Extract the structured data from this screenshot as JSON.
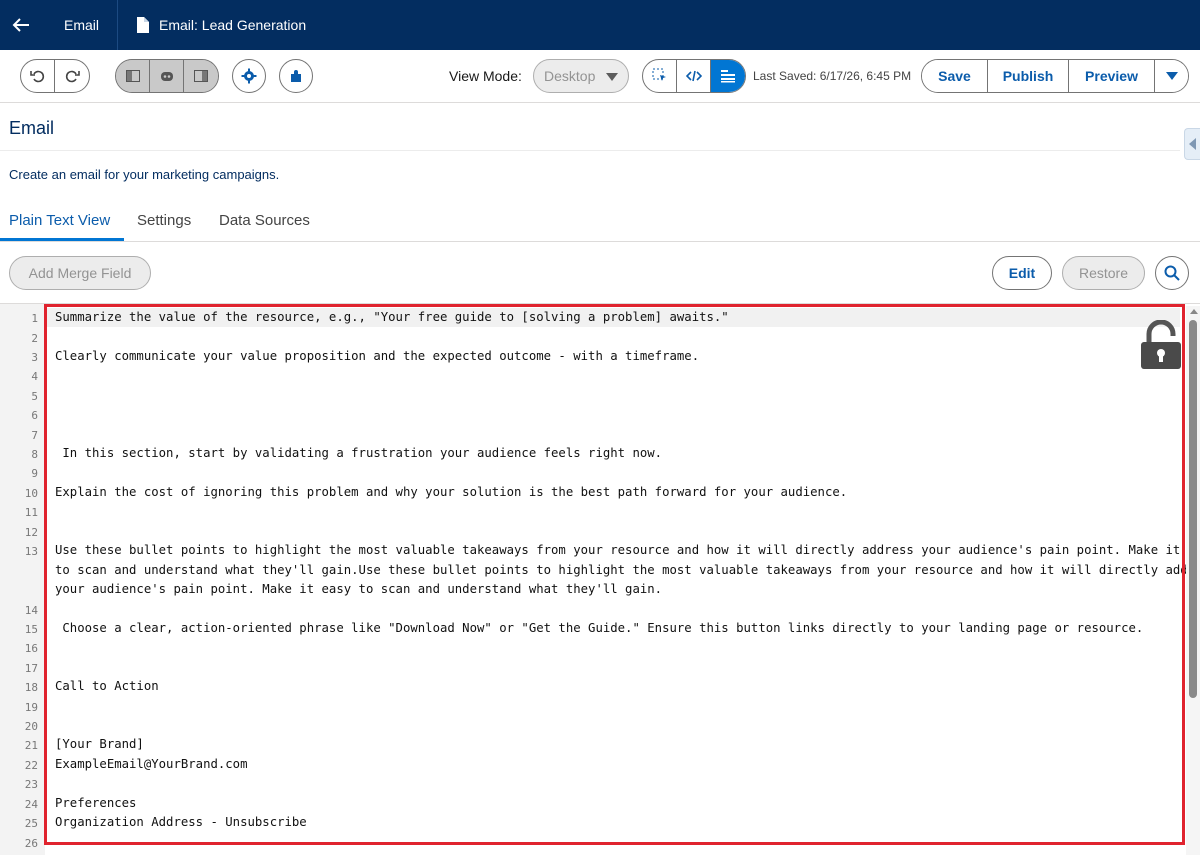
{
  "topbar": {
    "back_icon": "arrow-left-icon",
    "crumb1": "Email",
    "crumb2": "Email: Lead Generation",
    "doc_icon": "document-icon"
  },
  "toolbar": {
    "undo_icon": "undo-icon",
    "redo_icon": "redo-icon",
    "view_mode_label": "View Mode:",
    "view_mode_value": "Desktop",
    "last_saved": "Last Saved: 6/17/26, 6:45 PM",
    "save_label": "Save",
    "publish_label": "Publish",
    "preview_label": "Preview"
  },
  "header": {
    "title": "Email",
    "description": "Create an email for your marketing campaigns."
  },
  "tabs": [
    {
      "label": "Plain Text View",
      "active": true
    },
    {
      "label": "Settings",
      "active": false
    },
    {
      "label": "Data Sources",
      "active": false
    }
  ],
  "actions": {
    "add_merge_field": "Add Merge Field",
    "edit": "Edit",
    "restore": "Restore"
  },
  "editor": {
    "line_numbers": [
      "1",
      "2",
      "3",
      "4",
      "5",
      "6",
      "7",
      "8",
      "9",
      "10",
      "11",
      "12",
      "13",
      "14",
      "15",
      "16",
      "17",
      "18",
      "19",
      "20",
      "21",
      "22",
      "23",
      "24",
      "25",
      "26"
    ],
    "lines": [
      "Summarize the value of the resource, e.g., \"Your free guide to [solving a problem] awaits.\"",
      "Clearly communicate your value proposition and the expected outcome - with a timeframe.",
      " In this section, start by validating a frustration your audience feels right now.",
      "Explain the cost of ignoring this problem and why your solution is the best path forward for your audience.",
      "Use these bullet points to highlight the most valuable takeaways from your resource and how it will directly address your audience's pain point. Make it easy",
      "to scan and understand what they'll gain.Use these bullet points to highlight the most valuable takeaways from your resource and how it will directly address",
      "your audience's pain point. Make it easy to scan and understand what they'll gain.",
      " Choose a clear, action-oriented phrase like \"Download Now\" or \"Get the Guide.\" Ensure this button links directly to your landing page or resource.",
      "Call to Action",
      "[Your Brand]",
      "ExampleEmail@YourBrand.com",
      "Preferences",
      "Organization Address - Unsubscribe"
    ],
    "lock_icon": "lock-icon"
  },
  "colors": {
    "nav": "#032d60",
    "accent": "#0176d3",
    "link": "#0b5cab",
    "highlight_border": "#e0232e"
  }
}
